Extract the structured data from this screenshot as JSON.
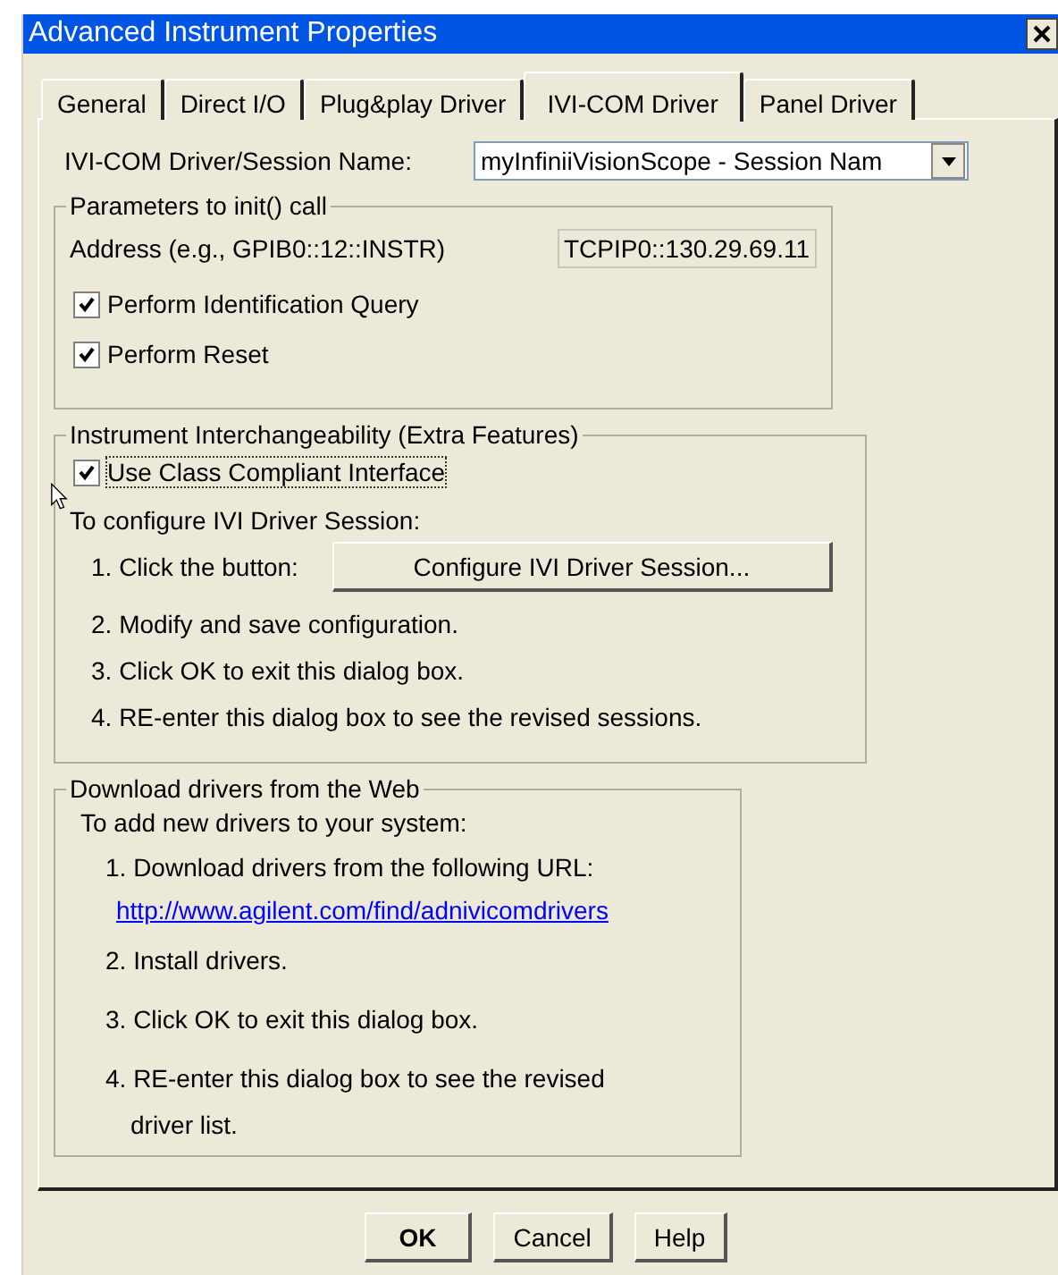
{
  "window": {
    "title": "Advanced Instrument Properties"
  },
  "tabs": [
    {
      "label": "General",
      "selected": false
    },
    {
      "label": "Direct I/O",
      "selected": false
    },
    {
      "label": "Plug&play Driver",
      "selected": false
    },
    {
      "label": "IVI-COM Driver",
      "selected": true
    },
    {
      "label": "Panel Driver",
      "selected": false
    }
  ],
  "session": {
    "label": "IVI-COM Driver/Session Name:",
    "value": "myInfiniiVisionScope - Session Nam"
  },
  "init_group": {
    "title": "Parameters to init() call",
    "address_label": "Address (e.g., GPIB0::12::INSTR)",
    "address_value": "TCPIP0::130.29.69.11",
    "checkboxes": [
      {
        "label": "Perform Identification Query",
        "checked": true
      },
      {
        "label": "Perform Reset",
        "checked": true
      }
    ]
  },
  "interchange_group": {
    "title": "Instrument Interchangeability (Extra Features)",
    "checkbox": {
      "label": "Use Class Compliant Interface",
      "checked": true,
      "focused": true
    },
    "intro": "To configure IVI Driver Session:",
    "steps": [
      {
        "kind": "button",
        "text": "1. Click the button:",
        "button": "Configure IVI Driver Session..."
      },
      {
        "kind": "text",
        "text": "2. Modify and save configuration."
      },
      {
        "kind": "text",
        "text": "3. Click OK to exit this dialog box."
      },
      {
        "kind": "text",
        "text": "4. RE-enter this dialog box to see the revised sessions."
      }
    ]
  },
  "download_group": {
    "title": "Download drivers from the Web",
    "intro": "To add new drivers to your system:",
    "steps": [
      {
        "kind": "text",
        "text": "1. Download drivers from the following URL:"
      },
      {
        "kind": "link",
        "text": "http://www.agilent.com/find/adnivicomdrivers"
      },
      {
        "kind": "text",
        "text": "2. Install drivers."
      },
      {
        "kind": "text",
        "text": "3. Click OK to exit this dialog box."
      },
      {
        "kind": "text",
        "text": "4. RE-enter this dialog box to see the revised driver list."
      }
    ]
  },
  "buttons": [
    {
      "label": "OK",
      "default": true
    },
    {
      "label": "Cancel",
      "default": false
    },
    {
      "label": "Help",
      "default": false
    }
  ]
}
